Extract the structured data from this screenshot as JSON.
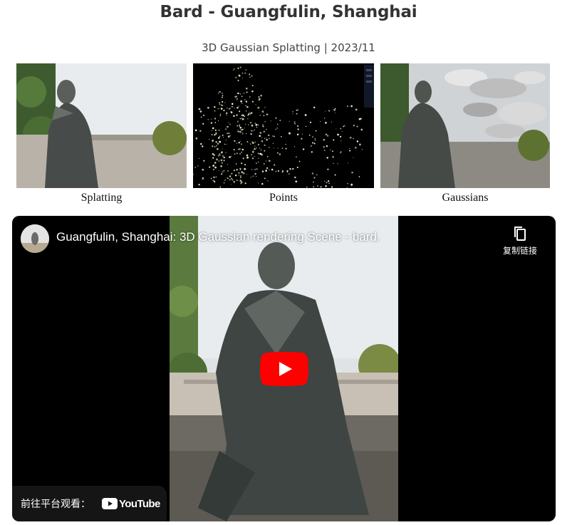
{
  "page": {
    "title": "Bard - Guangfulin, Shanghai",
    "subtitle": "3D Gaussian Splatting | 2023/11"
  },
  "gallery": [
    {
      "caption": "Splatting"
    },
    {
      "caption": "Points"
    },
    {
      "caption": "Gaussians"
    }
  ],
  "video": {
    "title": "Guangfulin, Shanghai: 3D Gaussian rendering Scene - bard.",
    "copy_link_label": "复制链接",
    "watch_on_label": "前往平台观看：",
    "platform_name": "YouTube"
  },
  "colors": {
    "play_red": "#ff0000",
    "overlay_dark": "#171717"
  }
}
